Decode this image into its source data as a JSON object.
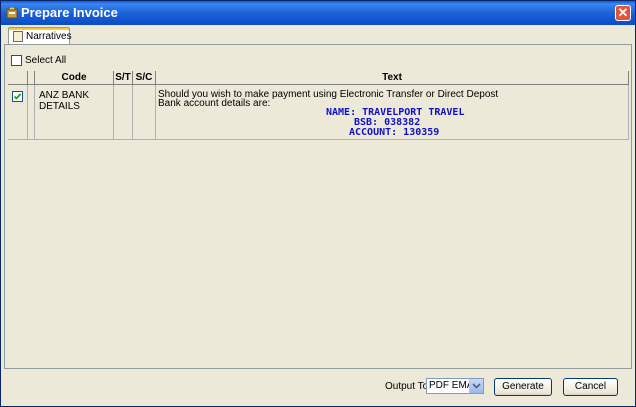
{
  "window": {
    "title": "Prepare  Invoice"
  },
  "tabs": [
    {
      "label": "Narratives",
      "icon": "list-icon"
    }
  ],
  "select_all": {
    "label": "Select All",
    "checked": false
  },
  "table": {
    "columns": [
      "",
      "",
      "Code",
      "S/T",
      "S/C",
      "Text"
    ],
    "rows": [
      {
        "checked": true,
        "code": "ANZ BANK DETAILS",
        "st": "",
        "sc": "",
        "text_lines": [
          "Should you wish to make payment using  Electronic Transfer or Direct Depost",
          "Bank account details are:"
        ],
        "details": [
          "NAME:  TRAVELPORT TRAVEL",
          "BSB:     038382",
          "ACCOUNT:  130359"
        ]
      }
    ]
  },
  "footer": {
    "output_label": "Output To:",
    "output_value": "PDF EMAIL",
    "generate_label": "Generate",
    "cancel_label": "Cancel"
  },
  "colors": {
    "title_bar": "#1c62d8",
    "detail_text": "#1010c8",
    "close": "#e0553a"
  }
}
